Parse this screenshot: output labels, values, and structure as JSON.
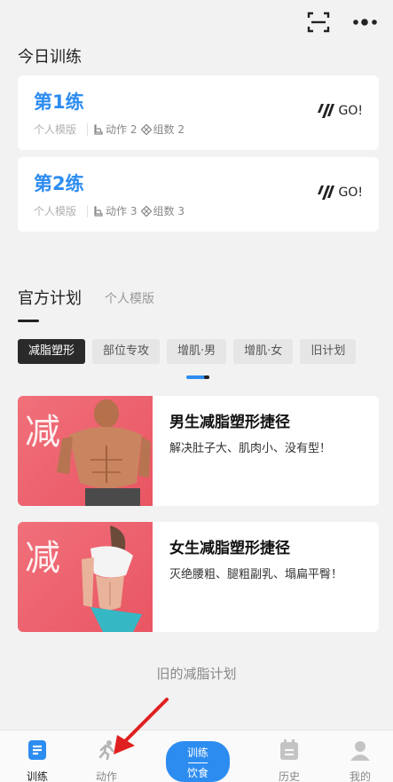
{
  "header": {
    "scan_icon": "scan-icon",
    "more_icon": "more-icon"
  },
  "today": {
    "title": "今日训练",
    "cards": [
      {
        "name": "第1练",
        "template": "个人模版",
        "actions_label": "动作",
        "actions": "2",
        "sets_label": "组数",
        "sets": "2",
        "go": "GO!"
      },
      {
        "name": "第2练",
        "template": "个人模版",
        "actions_label": "动作",
        "actions": "3",
        "sets_label": "组数",
        "sets": "3",
        "go": "GO!"
      }
    ]
  },
  "plans": {
    "tab_active": "官方计划",
    "tab_other": "个人模版",
    "chips": [
      "减脂塑形",
      "部位专攻",
      "增肌·男",
      "增肌·女",
      "旧计划"
    ],
    "items": [
      {
        "badge": "减",
        "title": "男生减脂塑形捷径",
        "desc": "解决肚子大、肌肉小、没有型！"
      },
      {
        "badge": "减",
        "title": "女生减脂塑形捷径",
        "desc": "灭绝腰粗、腿粗副乳、塌扁平臀！"
      }
    ],
    "old_plans_link": "旧的减脂计划"
  },
  "nav": {
    "items": [
      {
        "label": "训练",
        "icon": "document-icon"
      },
      {
        "label": "动作",
        "icon": "running-icon"
      },
      {
        "label": "历史",
        "icon": "calendar-icon"
      },
      {
        "label": "我的",
        "icon": "profile-icon"
      }
    ],
    "center_top": "训练",
    "center_bottom": "饮食"
  },
  "colors": {
    "accent": "#2d8cf0",
    "annotation": "#e02020",
    "plan_bg": "#ee6470"
  }
}
